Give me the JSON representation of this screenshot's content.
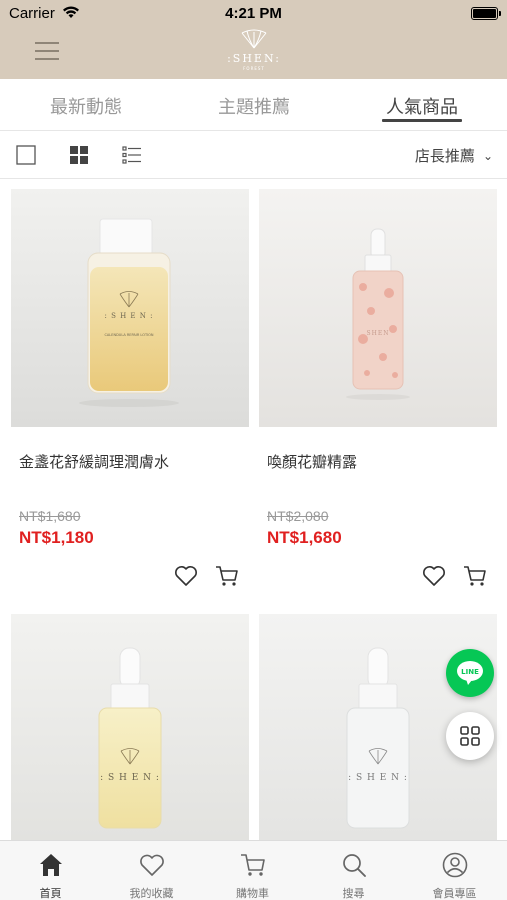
{
  "status_bar": {
    "carrier": "Carrier",
    "time": "4:21 PM"
  },
  "header": {
    "logo_text": ":SHEN:",
    "logo_sub": "FOREST"
  },
  "tabs": [
    {
      "label": "最新動態",
      "active": false
    },
    {
      "label": "主題推薦",
      "active": false
    },
    {
      "label": "人氣商品",
      "active": true
    }
  ],
  "toolbar": {
    "sort_label": "店長推薦"
  },
  "products": [
    {
      "name": "金盞花舒緩調理潤膚水",
      "original_price": "NT$1,680",
      "sale_price": "NT$1,180",
      "bottle_label": "CALENDULA REPAIR LOTION"
    },
    {
      "name": "喚顏花瓣精露",
      "original_price": "NT$2,080",
      "sale_price": "NT$1,680",
      "bottle_label": ""
    },
    {
      "name": "",
      "original_price": "",
      "sale_price": "",
      "bottle_label": ""
    },
    {
      "name": "",
      "original_price": "",
      "sale_price": "",
      "bottle_label": ""
    }
  ],
  "floating": {
    "line_label": "LINE"
  },
  "bottom_nav": [
    {
      "label": "首頁",
      "icon": "home-icon",
      "active": true
    },
    {
      "label": "我的收藏",
      "icon": "heart-icon",
      "active": false
    },
    {
      "label": "購物車",
      "icon": "cart-icon",
      "active": false
    },
    {
      "label": "搜尋",
      "icon": "search-icon",
      "active": false
    },
    {
      "label": "會員專區",
      "icon": "user-icon",
      "active": false
    }
  ],
  "colors": {
    "header_bg": "#d7cbbb",
    "price_red": "#e02020",
    "line_green": "#06c755"
  }
}
